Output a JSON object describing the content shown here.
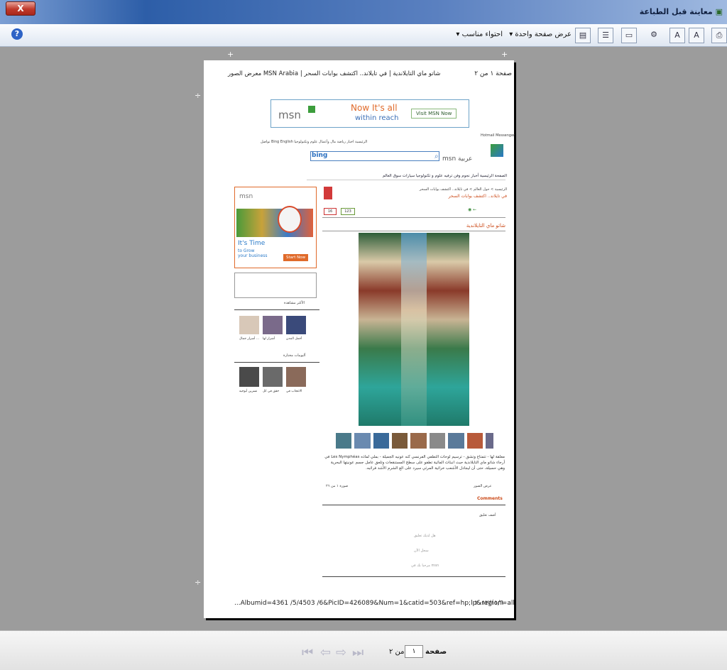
{
  "window": {
    "title": "معاينة قبل الطباعة",
    "close_label": "X"
  },
  "toolbar": {
    "view_mode_label": "عرض صفحة واحدة",
    "fit_label": "احتواء مناسب",
    "icons": [
      "print-icon",
      "portrait-icon",
      "landscape-icon",
      "page-setup-icon",
      "header-footer-icon",
      "full-width-icon",
      "full-page-icon",
      "multi-page-icon",
      "help-icon"
    ]
  },
  "page": {
    "header_left": "صفحة ١ من ٢",
    "header_right": "شاتو ماي التايلاندية | في تايلاند.. اكتشف بوابات السحر | MSN Arabia معرض الصور",
    "footer_url": "...Albumid=4361 /5/4503 /6&PicID=426089&Num=1&catid=503&ref=hp;lp&region=all",
    "footer_date": "٢٠١٢/١١/٦",
    "banner": {
      "line1": "Now It's all",
      "line2": "within reach",
      "button": "Visit MSN Now",
      "brand": "msn"
    },
    "topnav": "الرئيسية  اخبار  رياضة  مال وأعمال  علوم وتكنولوجيا  Bing  English  تواصل",
    "mail_links": "Hotmail  Messenger",
    "search_brand": "bing",
    "logo_text": "msn عربية",
    "menu": "الصفحة الرئيسية   أخبار   نجوم وفن   ترفيه   علوم و تكنولوجيا   سيارات   سوق العالم",
    "breadcrumb": "الرئيسية > حول العالم > في تايلاند.. اكتشف بوابات السحر",
    "article_title": "في تايلاند.. اكتشف بوابات السحر",
    "photo_title": "شاتو ماي التايلاندية",
    "share_count": "123",
    "like_count": "16",
    "ad": {
      "brand": "msn",
      "line1": "It's Time",
      "line2": "to Grow",
      "line3": "your business",
      "button": "Start Now"
    },
    "most_viewed_label": "الأكثر مشاهدة",
    "featured_label": "ألبومات مختارة",
    "thumbs_row1": [
      "أسرار جمال ...",
      "أشرار لها",
      "أجمل المدن"
    ],
    "thumbs_row2": [
      "نسرين أبوجيه",
      "حقق في كل",
      "الاعجاب في"
    ],
    "caption": "معلقة لها - تتمتاع وتشق - ترسيم لوحات التطفي الفرنسي كنه عونيه الجميلة - بملي لماذه Les Nymphéas في أرجاء شاتو ماي التايلاندية حيث انبثاث المائية تطفو على سطح المستنقعات وتلعق عامل جسم عونيتها البحرية وهي حسيلة، حتى أن ليجادل الأشعب خرائية المرئي سيرد على الغ الشرم الأشد فرائبه.",
    "meta_left": "عرض الصور",
    "meta_right": "صورة ١ من ٢٦",
    "comments_label": "Comments",
    "add_comment": "أضف تعليق",
    "comment_lines": [
      "هل لديك تعليق",
      "سجل الآن",
      "مرحبا بك في msn"
    ]
  },
  "bottom": {
    "page_label": "صفحة",
    "page_value": "١",
    "of_label": "من ٢"
  }
}
